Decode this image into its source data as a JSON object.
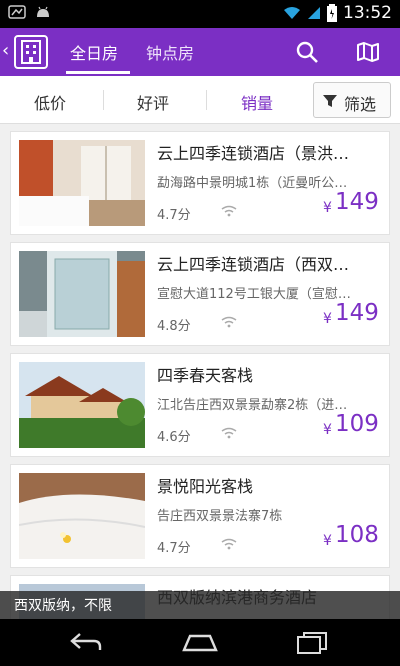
{
  "status_bar": {
    "time": "13:52",
    "icons": [
      "app-notification-icon",
      "android-icon",
      "wifi-icon",
      "signal-icon",
      "battery-icon"
    ]
  },
  "app_bar": {
    "tabs": [
      {
        "label": "全日房",
        "active": true
      },
      {
        "label": "钟点房",
        "active": false
      }
    ],
    "icons": [
      "hotel-logo-icon",
      "search-icon",
      "map-icon"
    ]
  },
  "filter_bar": {
    "sort_options": [
      {
        "label": "低价",
        "active": false
      },
      {
        "label": "好评",
        "active": false
      },
      {
        "label": "销量",
        "active": true
      }
    ],
    "filter_label": "筛选"
  },
  "hotels": [
    {
      "name": "云上四季连锁酒店（景洪…",
      "address": "勐海路中景明城1栋（近曼听公…",
      "score": "4.7分",
      "currency": "¥",
      "price": "149"
    },
    {
      "name": "云上四季连锁酒店（西双…",
      "address": "宣慰大道112号工银大厦（宣慰…",
      "score": "4.8分",
      "currency": "¥",
      "price": "149"
    },
    {
      "name": "四季春天客栈",
      "address": "江北告庄西双景景勐寨2栋（进…",
      "score": "4.6分",
      "currency": "¥",
      "price": "109"
    },
    {
      "name": "景悦阳光客栈",
      "address": "告庄西双景景法寨7栋",
      "score": "4.7分",
      "currency": "¥",
      "price": "108"
    },
    {
      "name": "西双版纳滨港商务酒店",
      "address": "",
      "score": "",
      "currency": "",
      "price": ""
    }
  ],
  "location_bar": {
    "text": "西双版纳，不限"
  },
  "colors": {
    "accent": "#7b2fc4",
    "background": "#f0f0f0"
  }
}
